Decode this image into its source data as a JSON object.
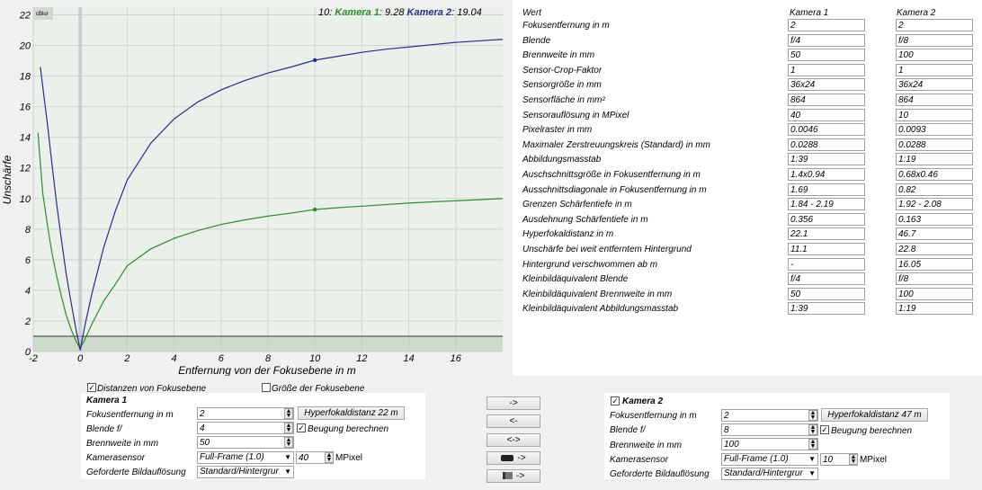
{
  "chart_data": {
    "type": "line",
    "title": "",
    "xlabel": "Entfernung von der Fokusebene in m",
    "ylabel": "Unschärfe",
    "xlim": [
      -2,
      18
    ],
    "ylim": [
      0,
      22.5
    ],
    "xticks": [
      -2,
      0,
      2,
      4,
      6,
      8,
      10,
      12,
      14,
      16
    ],
    "yticks": [
      0,
      2,
      4,
      6,
      8,
      10,
      12,
      14,
      16,
      18,
      20,
      22
    ],
    "xticklabels": [
      "-2",
      "0",
      "2",
      "4",
      "6",
      "8",
      "10",
      "12",
      "14",
      "16"
    ],
    "yticklabels": [
      "0",
      "2",
      "4",
      "6",
      "8",
      "10",
      "12",
      "14",
      "16",
      "18",
      "20",
      "22"
    ],
    "grid": true,
    "corner_label": "cBlur",
    "readout": {
      "x": "10",
      "s1_name": "Kamera 1",
      "s1_value": "9.28",
      "s2_name": "Kamera 2",
      "s2_value": "19.04"
    },
    "threshold_line": 1,
    "series": [
      {
        "name": "Kamera 1",
        "color": "#2e8b2e",
        "x": [
          -1.8,
          -1.6,
          -1.4,
          -1.2,
          -1.0,
          -0.8,
          -0.6,
          -0.4,
          -0.2,
          0,
          0.2,
          0.5,
          1,
          1.5,
          2,
          3,
          4,
          5,
          6,
          7,
          8,
          9,
          10,
          11,
          12,
          13,
          14,
          15,
          16,
          17,
          18
        ],
        "y": [
          14.3,
          10.4,
          8.3,
          6.4,
          4.9,
          3.6,
          2.4,
          1.5,
          0.75,
          0.2,
          0.8,
          1.8,
          3.3,
          4.4,
          5.6,
          6.7,
          7.4,
          7.9,
          8.3,
          8.6,
          8.85,
          9.05,
          9.28,
          9.4,
          9.5,
          9.6,
          9.7,
          9.78,
          9.85,
          9.92,
          10.0
        ]
      },
      {
        "name": "Kamera 2",
        "color": "#2b2b8c",
        "x": [
          -1.7,
          -1.4,
          -1.2,
          -1.0,
          -0.8,
          -0.6,
          -0.4,
          -0.2,
          0,
          0.2,
          0.5,
          1,
          1.5,
          2,
          3,
          4,
          5,
          6,
          7,
          8,
          9,
          10,
          11,
          12,
          13,
          14,
          15,
          16,
          17,
          18
        ],
        "y": [
          18.6,
          14.9,
          12.2,
          9.6,
          7.3,
          5.1,
          3.3,
          1.6,
          0.1,
          1.7,
          3.8,
          6.8,
          9.2,
          11.2,
          13.6,
          15.2,
          16.3,
          17.1,
          17.7,
          18.2,
          18.6,
          19.04,
          19.3,
          19.55,
          19.75,
          19.9,
          20.05,
          20.2,
          20.3,
          20.4
        ]
      }
    ],
    "markers": [
      {
        "series": "Kamera 1",
        "x": 10,
        "y": 9.28
      },
      {
        "series": "Kamera 2",
        "x": 10,
        "y": 19.04
      }
    ]
  },
  "table": {
    "col_header_label": "Wert",
    "col_header_cam1": "Kamera 1",
    "col_header_cam2": "Kamera 2",
    "rows": [
      {
        "label": "Fokusentfernung in m",
        "k1": "2",
        "k2": "2"
      },
      {
        "label": "Blende",
        "k1": "f/4",
        "k2": "f/8"
      },
      {
        "label": "Brennweite in mm",
        "k1": "50",
        "k2": "100"
      },
      {
        "label": "Sensor-Crop-Faktor",
        "k1": "1",
        "k2": "1"
      },
      {
        "label": "Sensorgröße in mm",
        "k1": "36x24",
        "k2": "36x24"
      },
      {
        "label": "Sensorfläche in mm²",
        "k1": "864",
        "k2": "864"
      },
      {
        "label": "Sensorauflösung in MPixel",
        "k1": "40",
        "k2": "10"
      },
      {
        "label": "Pixelraster in mm",
        "k1": "0.0046",
        "k2": "0.0093"
      },
      {
        "label": "Maximaler Zerstreuungskreis (Standard) in mm",
        "k1": "0.0288",
        "k2": "0.0288"
      },
      {
        "label": "Abbildungsmasstab",
        "k1": "1:39",
        "k2": "1:19"
      },
      {
        "label": "Auschschnittsgröße in Fokusentfernung in m",
        "k1": "1.4x0.94",
        "k2": "0.68x0.46"
      },
      {
        "label": "Ausschnittsdiagonale in Fokusentfernung in m",
        "k1": "1.69",
        "k2": "0.82"
      },
      {
        "label": "Grenzen Schärfentiefe in m",
        "k1": "1.84 - 2.19",
        "k2": "1.92 - 2.08"
      },
      {
        "label": "Ausdehnung Schärfentiefe in m",
        "k1": "0.356",
        "k2": "0.163"
      },
      {
        "label": "Hyperfokaldistanz in m",
        "k1": "22.1",
        "k2": "46.7"
      },
      {
        "label": "Unschärfe bei weit entferntem Hintergrund",
        "k1": "11.1",
        "k2": "22.8"
      },
      {
        "label": "Hintergrund verschwommen ab m",
        "k1": "-",
        "k2": "16.05"
      },
      {
        "label": "Kleinbildäquivalent Blende",
        "k1": "f/4",
        "k2": "f/8"
      },
      {
        "label": "Kleinbildäquivalent Brennweite in mm",
        "k1": "50",
        "k2": "100"
      },
      {
        "label": "Kleinbildäquivalent Abbildungsmasstab",
        "k1": "1:39",
        "k2": "1:19"
      }
    ]
  },
  "options": {
    "distances_label": "Distanzen von Fokusebene",
    "distances_checked": true,
    "size_label": "Größe der Fokusebene",
    "size_checked": false
  },
  "cam1": {
    "title": "Kamera 1",
    "focus_label": "Fokusentfernung in m",
    "focus_value": "2",
    "hyper_button": "Hyperfokaldistanz 22 m",
    "aperture_label": "Blende f/",
    "aperture_value": "4",
    "diffraction_label": "Beugung berechnen",
    "diffraction_checked": true,
    "focal_label": "Brennweite in mm",
    "focal_value": "50",
    "sensor_label": "Kamerasensor",
    "sensor_value": "Full-Frame (1.0)",
    "mpixel_value": "40",
    "mpixel_label": "MPixel",
    "resolution_label": "Geforderte Bildauflösung",
    "resolution_value": "Standard/Hintergrur"
  },
  "cam2": {
    "title": "Kamera 2",
    "title_checked": true,
    "focus_label": "Fokusentfernung in m",
    "focus_value": "2",
    "hyper_button": "Hyperfokaldistanz 47 m",
    "aperture_label": "Blende f/",
    "aperture_value": "8",
    "diffraction_label": "Beugung berechnen",
    "diffraction_checked": true,
    "focal_label": "Brennweite in mm",
    "focal_value": "100",
    "sensor_label": "Kamerasensor",
    "sensor_value": "Full-Frame (1.0)",
    "mpixel_value": "10",
    "mpixel_label": "MPixel",
    "resolution_label": "Geforderte Bildauflösung",
    "resolution_value": "Standard/Hintergrur"
  },
  "copy_buttons": {
    "to_right": "->",
    "to_left": "<-",
    "swap": "<->",
    "camera_copy": "->",
    "lens_copy": "->"
  }
}
